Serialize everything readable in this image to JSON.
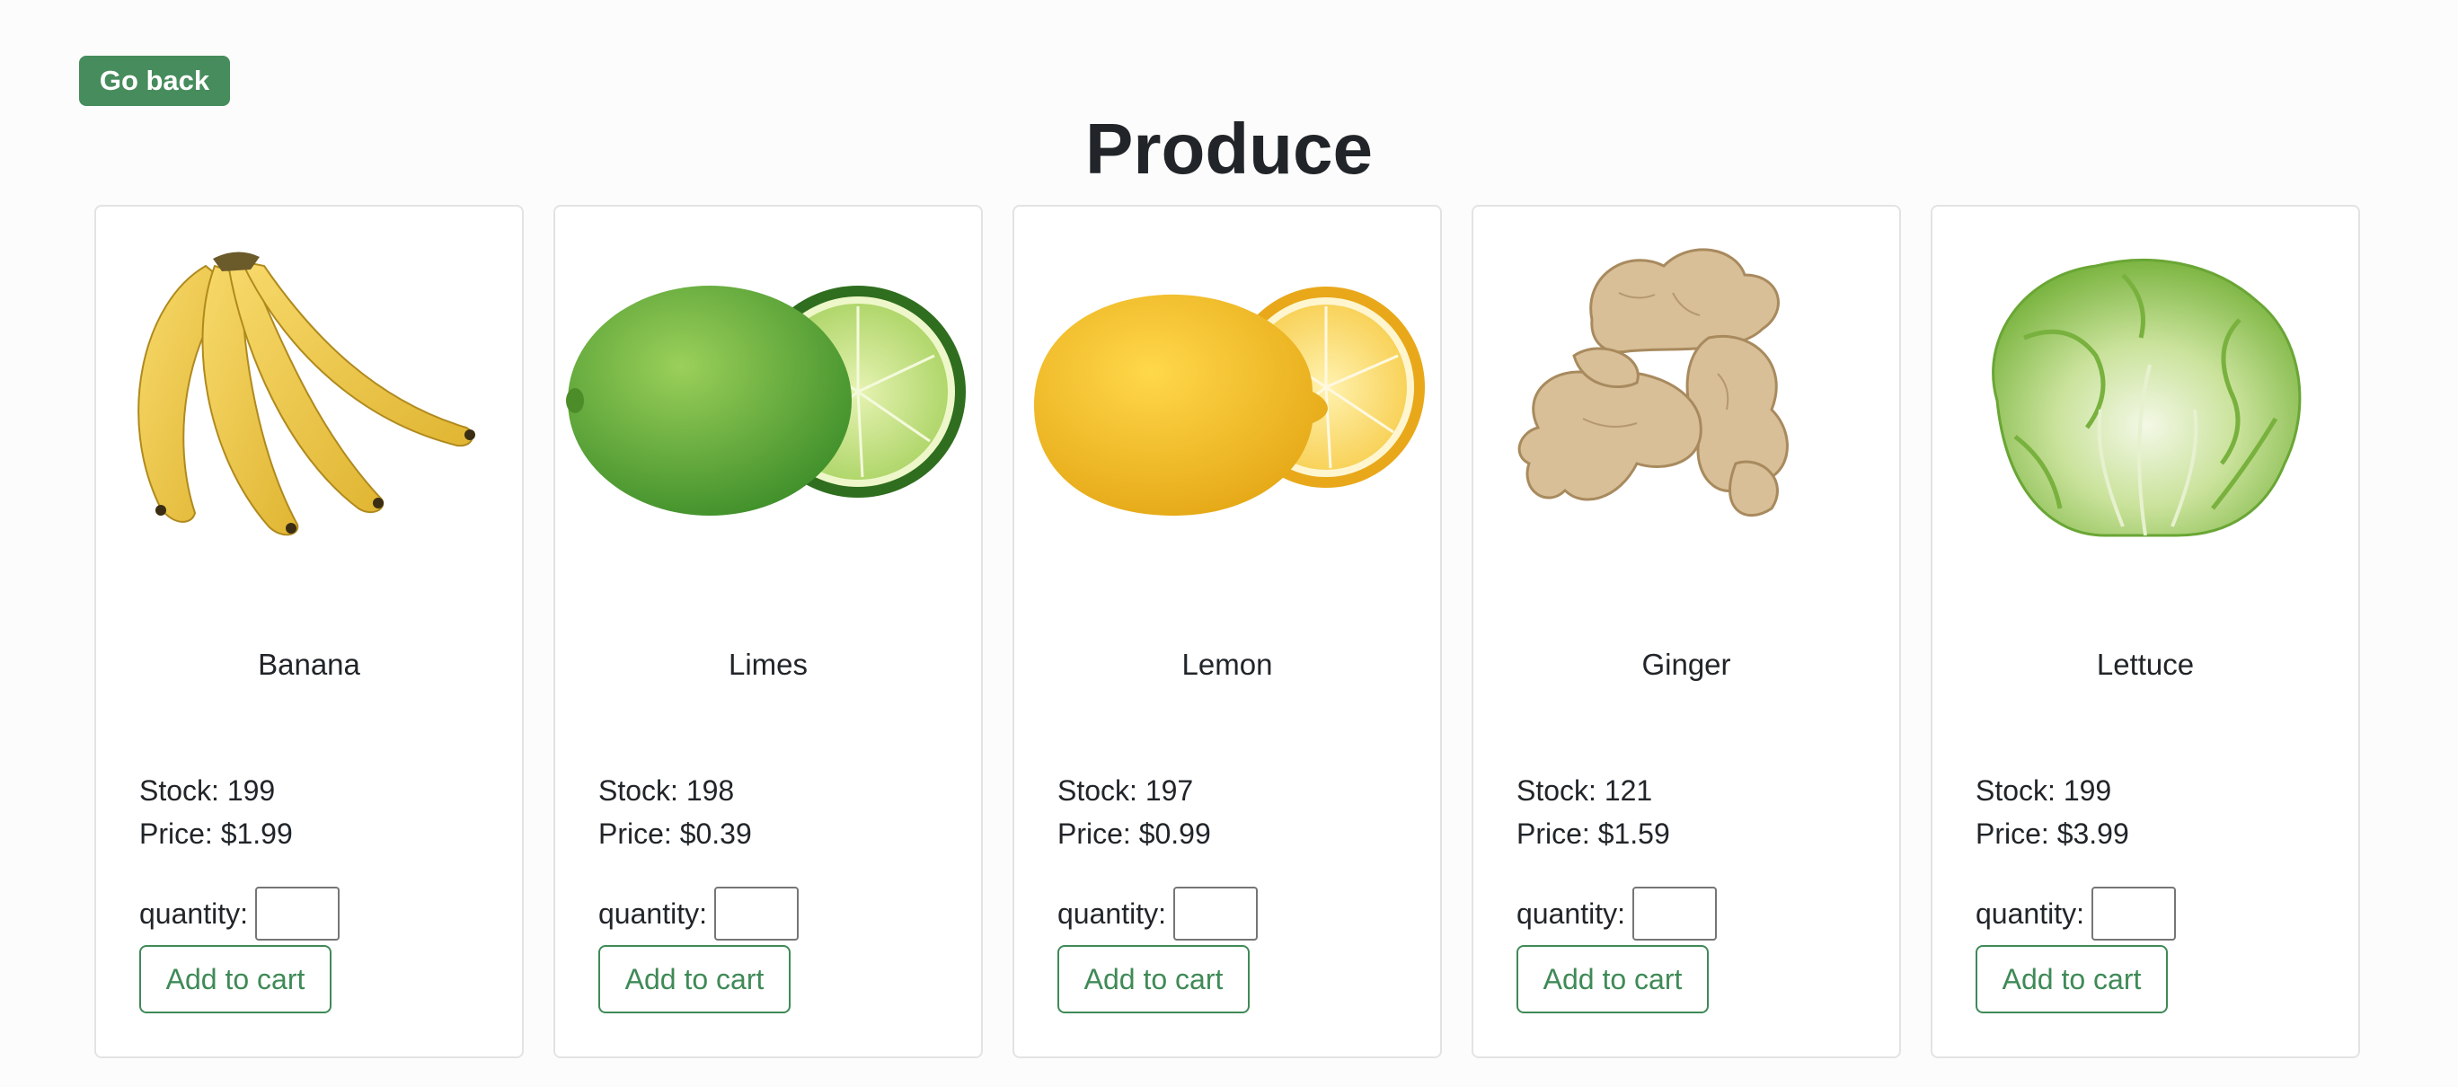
{
  "header": {
    "back_label": "Go back",
    "title": "Produce"
  },
  "colors": {
    "primary_green": "#478c5c",
    "outline_green": "#3f8a57",
    "card_border": "#e3e3e3"
  },
  "products": [
    {
      "name": "Banana",
      "stock": "Stock: 199",
      "price": "Price: $1.99",
      "image_icon": "banana-image"
    },
    {
      "name": "Limes",
      "stock": "Stock: 198",
      "price": "Price: $0.39",
      "image_icon": "lime-image"
    },
    {
      "name": "Lemon",
      "stock": "Stock: 197",
      "price": "Price: $0.99",
      "image_icon": "lemon-image"
    },
    {
      "name": "Ginger",
      "stock": "Stock: 121",
      "price": "Price: $1.59",
      "image_icon": "ginger-image"
    },
    {
      "name": "Lettuce",
      "stock": "Stock: 199",
      "price": "Price: $3.99",
      "image_icon": "lettuce-image"
    }
  ],
  "card_labels": {
    "quantity_label": "quantity:",
    "quantity_value": "",
    "add_to_cart_label": "Add to cart"
  }
}
